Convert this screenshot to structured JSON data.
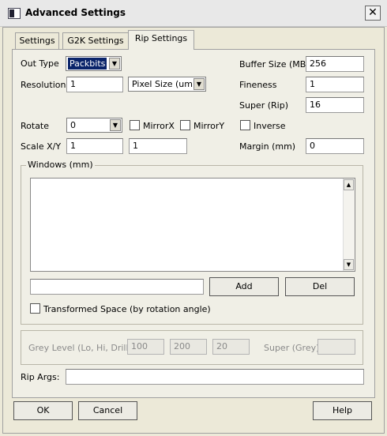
{
  "window": {
    "title": "Advanced Settings",
    "close": "✕"
  },
  "tabs": [
    "Settings",
    "G2K Settings",
    "Rip Settings"
  ],
  "rip": {
    "out_type_label": "Out Type",
    "out_type_value": "Packbits",
    "resolution_label": "Resolution",
    "resolution_value": "1",
    "unit_value": "Pixel Size (um)",
    "rotate_label": "Rotate",
    "rotate_value": "0",
    "mirrorx_label": "MirrorX",
    "mirrory_label": "MirrorY",
    "scale_label": "Scale X/Y",
    "scale_x": "1",
    "scale_y": "1",
    "buffer_label": "Buffer Size (MB)",
    "buffer_value": "256",
    "fineness_label": "Fineness",
    "fineness_value": "1",
    "super_label": "Super (Rip)",
    "super_value": "16",
    "inverse_label": "Inverse",
    "margin_label": "Margin (mm)",
    "margin_value": "0"
  },
  "windows": {
    "legend": "Windows (mm)",
    "entry_value": "",
    "add_label": "Add",
    "del_label": "Del",
    "transformed_label": "Transformed Space (by rotation angle)"
  },
  "grey": {
    "label": "Grey Level (Lo, Hi, Drill):",
    "lo": "100",
    "hi": "200",
    "drill": "20",
    "super_label": "Super (Grey)",
    "super_value": ""
  },
  "rip_args": {
    "label": "Rip Args:",
    "value": ""
  },
  "footer": {
    "ok": "OK",
    "cancel": "Cancel",
    "help": "Help"
  }
}
